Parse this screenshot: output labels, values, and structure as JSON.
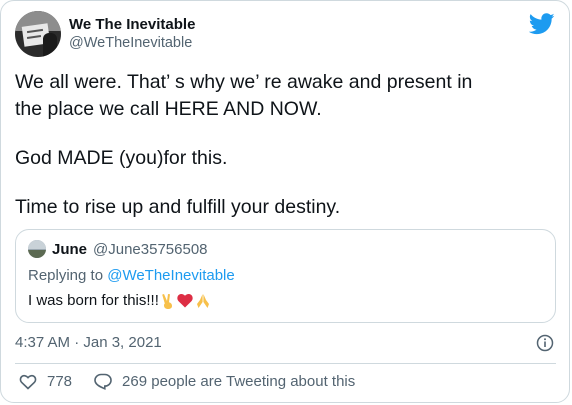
{
  "tweet": {
    "author": {
      "display_name": "We The Inevitable",
      "handle": "@WeTheInevitable"
    },
    "logo_icon": "twitter-bird-icon",
    "body": {
      "line1": "We all were. That’ s why we’ re awake and present in",
      "line2": "the place we call HERE AND NOW.",
      "line3": "God MADE (you)for this.",
      "line4": "Time to rise up and fulfill your destiny."
    },
    "quoted": {
      "display_name": "June",
      "handle": "@June35756508",
      "replying_prefix": "Replying to ",
      "replying_to": "@WeTheInevitable",
      "text": "I was born for this!!!",
      "emojis": [
        "victory-hand",
        "red-heart",
        "folded-hands"
      ]
    },
    "timestamp": "4:37 AM · Jan 3, 2021",
    "likes": "778",
    "replies_label": "269 people are Tweeting about this"
  },
  "colors": {
    "brand": "#1d9bf0",
    "text_primary": "#0f1419",
    "text_secondary": "#536471",
    "border": "#cfd9de",
    "heart": "#e0245e"
  }
}
